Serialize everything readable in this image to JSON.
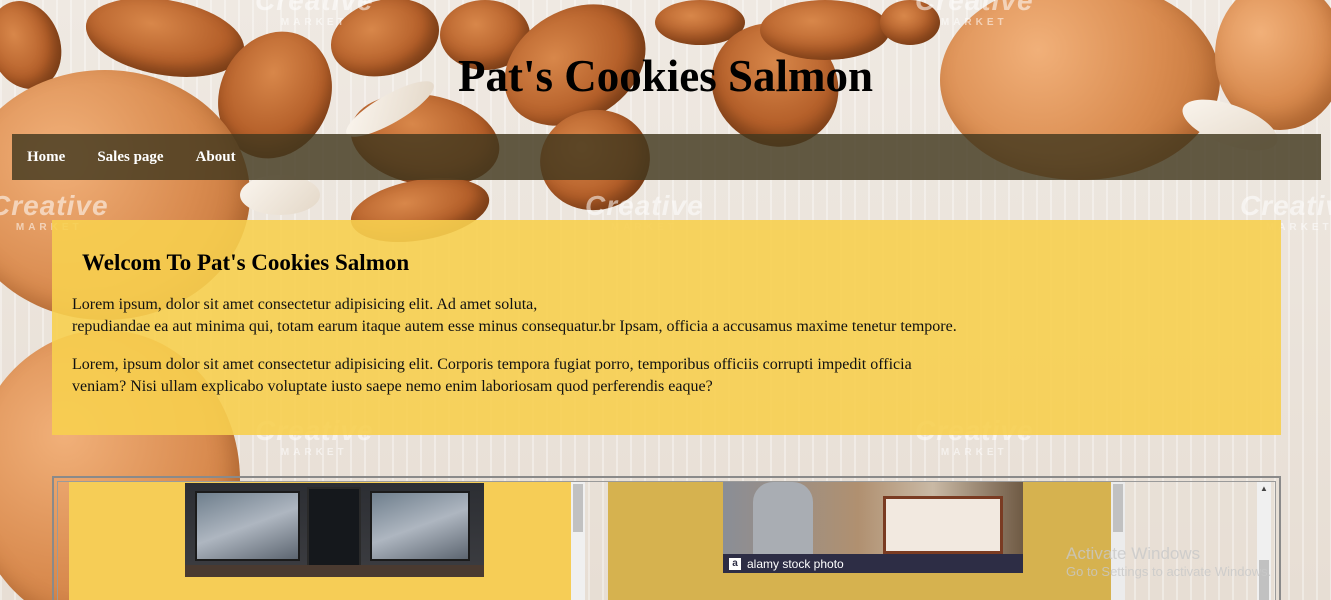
{
  "header": {
    "title": "Pat's Cookies Salmon"
  },
  "nav": {
    "items": [
      {
        "label": "Home"
      },
      {
        "label": "Sales page"
      },
      {
        "label": "About"
      }
    ]
  },
  "welcome": {
    "heading": "Welcom To Pat's Cookies Salmon",
    "paragraph1_line1": "Lorem ipsum, dolor sit amet consectetur adipisicing elit. Ad amet soluta,",
    "paragraph1_line2": "repudiandae ea aut minima qui, totam earum itaque autem esse minus consequatur.br Ipsam, officia a accusamus maxime tenetur tempore.",
    "paragraph2_line1": "Lorem, ipsum dolor sit amet consectetur adipisicing elit. Corporis tempora fugiat porro, temporibus officiis corrupti impedit officia",
    "paragraph2_line2": "veniam? Nisi ullam explicabo voluptate iusto saepe nemo enim laboriosam quod perferendis eaque?"
  },
  "gallery": {
    "photo2_caption": "alamy stock photo",
    "photo2_logo": "a"
  },
  "watermarks": {
    "brand": "Creative",
    "sub": "MARKET"
  },
  "os_notice": {
    "title": "Activate Windows",
    "subtitle": "Go to Settings to activate Windows."
  },
  "colors": {
    "nav_bg": "#42381e",
    "welcome_bg": "#f7cf4f",
    "card1_bg": "#f6cd56",
    "card2_bg": "#d6b24f"
  }
}
